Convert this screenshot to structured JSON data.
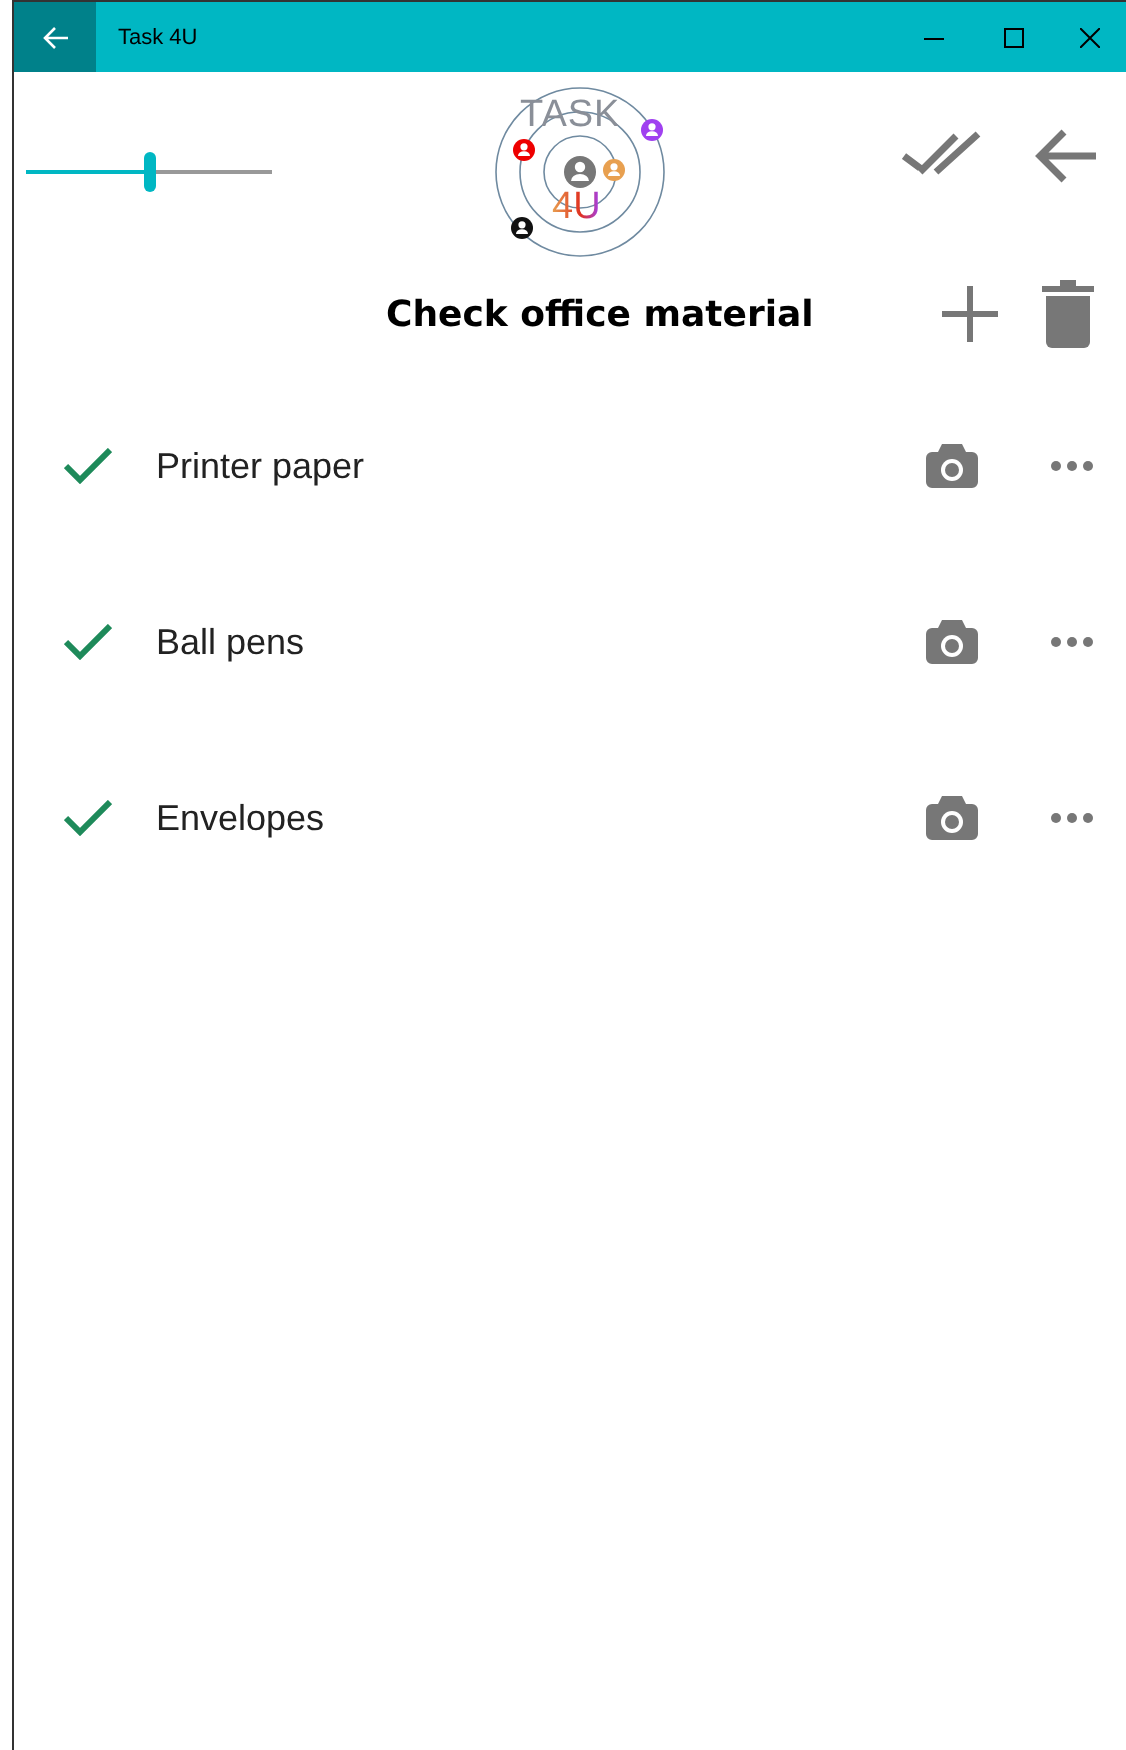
{
  "window": {
    "title": "Task 4U"
  },
  "zoom_slider": {
    "level": 0.5
  },
  "logo": {
    "top_text": "TASK",
    "bottom_text": "4U"
  },
  "list": {
    "title": "Check office material"
  },
  "items": [
    {
      "label": "Printer paper",
      "checked": true
    },
    {
      "label": "Ball pens",
      "checked": true
    },
    {
      "label": "Envelopes",
      "checked": true
    }
  ]
}
